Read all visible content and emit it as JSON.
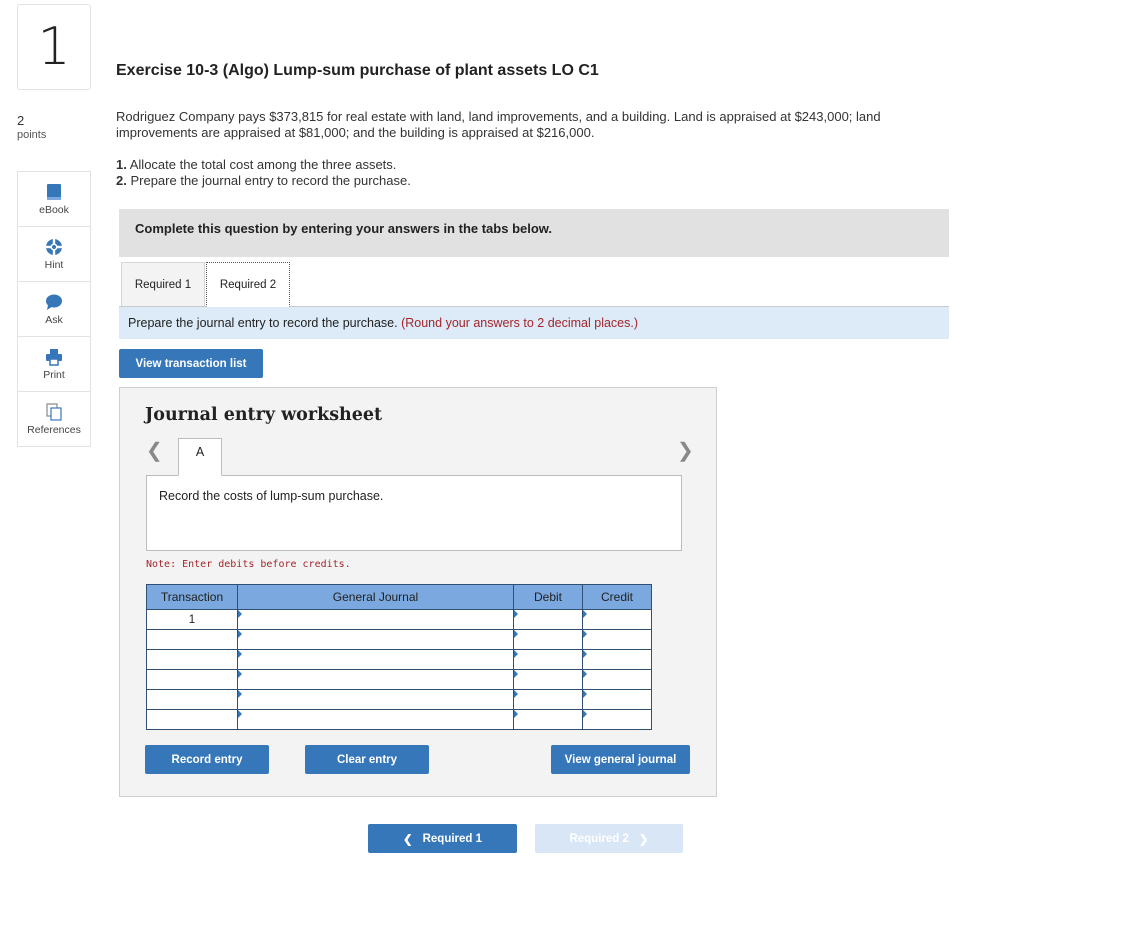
{
  "question": {
    "number": "1",
    "points_value": "2",
    "points_label": "points"
  },
  "tools": [
    {
      "label": "eBook",
      "icon": "book-icon"
    },
    {
      "label": "Hint",
      "icon": "lifebuoy-icon"
    },
    {
      "label": "Ask",
      "icon": "chat-bubble-icon"
    },
    {
      "label": "Print",
      "icon": "printer-icon"
    },
    {
      "label": "References",
      "icon": "references-icon"
    }
  ],
  "exercise": {
    "title": "Exercise 10-3 (Algo) Lump-sum purchase of plant assets LO C1",
    "intro": "Rodriguez Company pays $373,815 for real estate with land, land improvements, and a building. Land is appraised at $243,000; land improvements are appraised at $81,000; and the building is appraised at $216,000.",
    "steps": [
      {
        "num": "1.",
        "text": "Allocate the total cost among the three assets."
      },
      {
        "num": "2.",
        "text": "Prepare the journal entry to record the purchase."
      }
    ]
  },
  "banner": "Complete this question by entering your answers in the tabs below.",
  "tabs": [
    {
      "label": "Required 1",
      "active": false
    },
    {
      "label": "Required 2",
      "active": true
    }
  ],
  "instruction": {
    "text": "Prepare the journal entry to record the purchase.",
    "note": "(Round your answers to 2 decimal places.)"
  },
  "view_transaction_list": "View transaction list",
  "worksheet": {
    "title": "Journal entry worksheet",
    "entry_tab": "A",
    "prev_icon": "chevron-left-icon",
    "next_icon": "chevron-right-icon",
    "description": "Record the costs of lump-sum purchase.",
    "note": "Note: Enter debits before credits.",
    "columns": [
      "Transaction",
      "General Journal",
      "Debit",
      "Credit"
    ],
    "rows": [
      {
        "transaction": "1",
        "account": "",
        "debit": "",
        "credit": ""
      },
      {
        "transaction": "",
        "account": "",
        "debit": "",
        "credit": ""
      },
      {
        "transaction": "",
        "account": "",
        "debit": "",
        "credit": ""
      },
      {
        "transaction": "",
        "account": "",
        "debit": "",
        "credit": ""
      },
      {
        "transaction": "",
        "account": "",
        "debit": "",
        "credit": ""
      },
      {
        "transaction": "",
        "account": "",
        "debit": "",
        "credit": ""
      }
    ],
    "buttons": {
      "record": "Record entry",
      "clear": "Clear entry",
      "view_journal": "View general journal"
    }
  },
  "nav": {
    "prev_label": "Required 1",
    "next_label": "Required 2",
    "next_disabled": true
  },
  "colors": {
    "primary_button": "#3677ba",
    "table_header": "#7ba8de",
    "instruction_bg": "#dcebf7",
    "note_red": "#a3262b"
  }
}
